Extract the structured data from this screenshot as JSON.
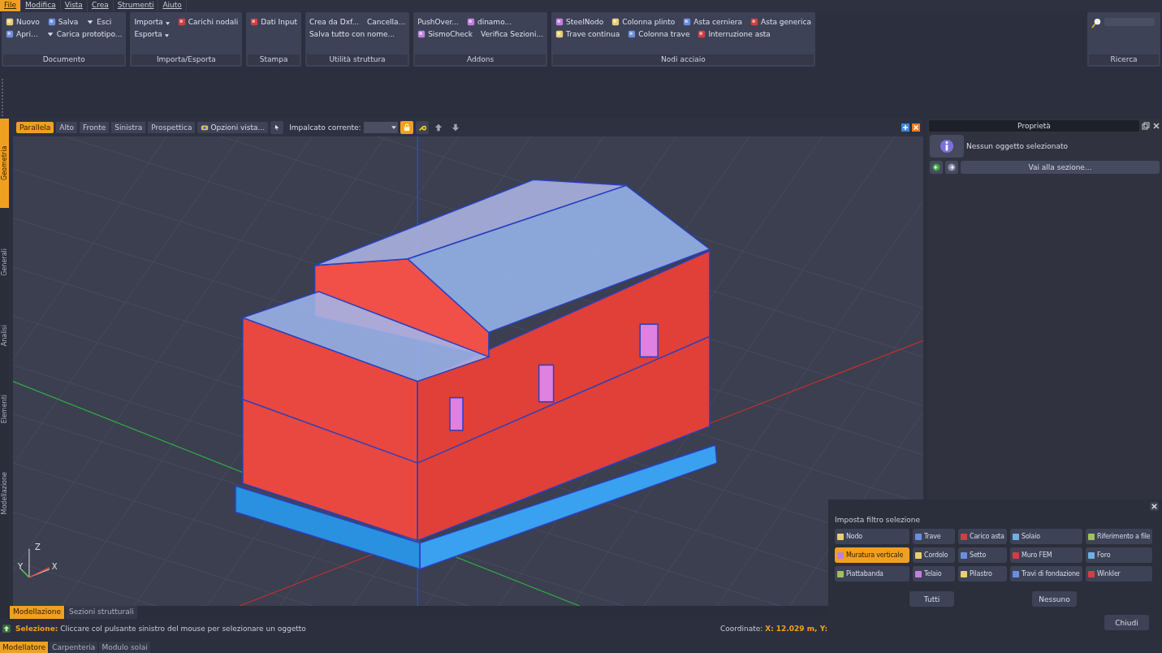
{
  "menu": [
    {
      "label": "File",
      "selected": true
    },
    {
      "label": "Modifica",
      "selected": false
    },
    {
      "label": "Vista",
      "selected": false
    },
    {
      "label": "Crea",
      "selected": false
    },
    {
      "label": "Strumenti",
      "selected": false
    },
    {
      "label": "Aiuto",
      "selected": false
    }
  ],
  "ribbon": [
    {
      "title": "Documento",
      "rows": [
        [
          {
            "label": "Nuovo",
            "kind": "icon"
          },
          {
            "label": "Salva",
            "kind": "icon"
          },
          {
            "label": "Esci",
            "kind": "caret"
          }
        ],
        [
          {
            "label": "Apri...",
            "kind": "icon"
          },
          {
            "label": "Carica prototipo...",
            "kind": "caret"
          }
        ]
      ]
    },
    {
      "title": "Importa/Esporta",
      "rows": [
        [
          {
            "label": "Importa",
            "kind": "dropdown"
          },
          {
            "label": "Carichi nodali",
            "kind": "icon"
          }
        ],
        [
          {
            "label": "Esporta",
            "kind": "dropdown"
          }
        ]
      ]
    },
    {
      "title": "Stampa",
      "rows": [
        [
          {
            "label": "Dati Input",
            "kind": "icon"
          }
        ]
      ]
    },
    {
      "title": "Utilità struttura",
      "rows": [
        [
          {
            "label": "Crea da Dxf...",
            "kind": "plain"
          },
          {
            "label": "Cancella...",
            "kind": "plain"
          }
        ],
        [
          {
            "label": "Salva tutto con nome...",
            "kind": "plain"
          }
        ]
      ]
    },
    {
      "title": "Addons",
      "rows": [
        [
          {
            "label": "PushOver...",
            "kind": "plain"
          },
          {
            "label": "dinamo...",
            "kind": "icon"
          }
        ],
        [
          {
            "label": "SismoCheck",
            "kind": "icon"
          },
          {
            "label": "Verifica Sezioni...",
            "kind": "plain"
          }
        ]
      ]
    },
    {
      "title": "Nodi acciaio",
      "rows": [
        [
          {
            "label": "SteelNodo",
            "kind": "icon"
          },
          {
            "label": "Colonna plinto",
            "kind": "icon"
          },
          {
            "label": "Asta cerniera",
            "kind": "icon"
          },
          {
            "label": "Asta generica",
            "kind": "icon"
          }
        ],
        [
          {
            "label": "Trave continua",
            "kind": "icon"
          },
          {
            "label": "Colonna trave",
            "kind": "icon"
          },
          {
            "label": "Interruzione asta",
            "kind": "icon"
          }
        ]
      ]
    }
  ],
  "search": {
    "title": "Ricerca"
  },
  "side_tabs": [
    {
      "label": "Geometria",
      "selected": true
    },
    {
      "label": "Generali",
      "selected": false
    },
    {
      "label": "Analisi",
      "selected": false
    },
    {
      "label": "Elementi",
      "selected": false
    },
    {
      "label": "Modellazione",
      "selected": false
    }
  ],
  "view_tabs": [
    {
      "label": "Parallela",
      "selected": true
    },
    {
      "label": "Alto",
      "selected": false
    },
    {
      "label": "Fronte",
      "selected": false
    },
    {
      "label": "Sinistra",
      "selected": false
    },
    {
      "label": "Prospettica",
      "selected": false
    }
  ],
  "view_options": "Opzioni vista...",
  "floor": {
    "label": "Impalcato corrente:",
    "locked": true
  },
  "gizmo": [
    "Z",
    "Y",
    "X"
  ],
  "properties": {
    "title": "Proprietà",
    "message": "Nessun oggetto selezionato",
    "goto": "Vai alla sezione..."
  },
  "filter": {
    "title": "Imposta filtro selezione",
    "items": [
      {
        "label": "Nodo",
        "selected": false
      },
      {
        "label": "Trave",
        "selected": false
      },
      {
        "label": "Carico asta",
        "selected": false
      },
      {
        "label": "Solaio",
        "selected": false
      },
      {
        "label": "Riferimento a file",
        "selected": false
      },
      {
        "label": "Muratura verticale",
        "selected": true
      },
      {
        "label": "Cordolo",
        "selected": false
      },
      {
        "label": "Setto",
        "selected": false
      },
      {
        "label": "Muro FEM",
        "selected": false
      },
      {
        "label": "Foro",
        "selected": false
      },
      {
        "label": "Piattabanda",
        "selected": false
      },
      {
        "label": "Telaio",
        "selected": false
      },
      {
        "label": "Pilastro",
        "selected": false
      },
      {
        "label": "Travi di fondazione",
        "selected": false
      },
      {
        "label": "Winkler",
        "selected": false
      }
    ],
    "all": "Tutti",
    "none": "Nessuno",
    "close": "Chiudi"
  },
  "view_bottom_tabs": [
    {
      "label": "Modellazione",
      "selected": true
    },
    {
      "label": "Sezioni strutturali",
      "selected": false
    }
  ],
  "status": {
    "message": "**Selezione:** Cliccare col pulsante sinistro del mouse per selezionare un oggetto",
    "coords": "Coordinate: **X: 12.029 m, Y:**"
  },
  "app_tabs": [
    {
      "label": "Modellatore",
      "selected": true
    },
    {
      "label": "Carpenteria",
      "selected": false
    },
    {
      "label": "Modulo solai",
      "selected": false
    }
  ]
}
